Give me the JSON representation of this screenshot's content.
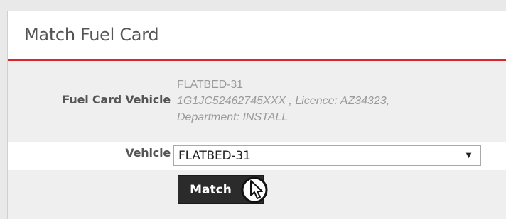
{
  "panel": {
    "title": "Match Fuel Card"
  },
  "fuel_card_vehicle": {
    "label": "Fuel Card Vehicle",
    "name": "FLATBED-31",
    "detail_line1": "1G1JC52462745XXX , Licence: AZ34323,",
    "detail_line2": "Department: INSTALL"
  },
  "vehicle": {
    "label": "Vehicle",
    "selected": "FLATBED-31"
  },
  "match_button": {
    "label": "Match"
  },
  "icons": {
    "dropdown": "chevron-down-icon",
    "cursor": "hand-pointer-icon"
  }
}
